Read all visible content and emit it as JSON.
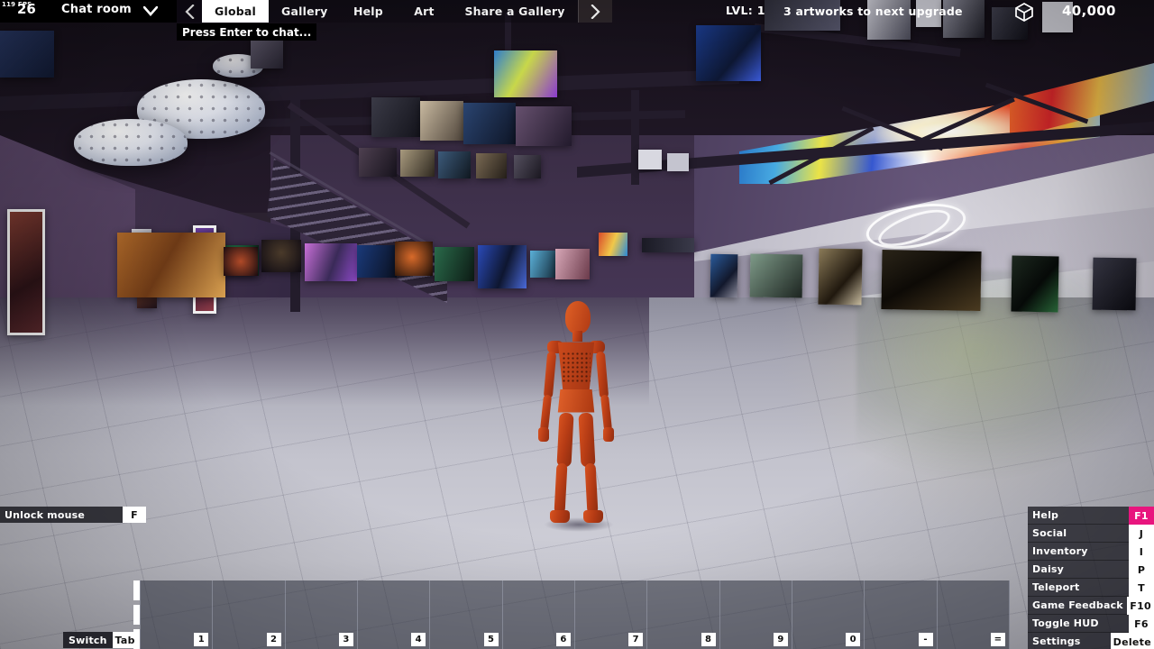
{
  "hud": {
    "performance": {
      "fps_label": "119 FPS",
      "ping": "26"
    },
    "chat": {
      "room_label": "Chat room",
      "dropdown_icon": "chevron-down-icon",
      "prev_icon": "chevron-left-icon",
      "next_icon": "chevron-right-icon",
      "hint": "Press Enter to chat...",
      "tabs": [
        {
          "label": "Global",
          "active": true
        },
        {
          "label": "Gallery",
          "active": false
        },
        {
          "label": "Help",
          "active": false
        },
        {
          "label": "Art",
          "active": false
        },
        {
          "label": "Share a Gallery",
          "active": false
        }
      ]
    },
    "status": {
      "level": "LVL: 1",
      "upgrade_progress": "3 artworks to next upgrade",
      "inventory_icon": "cube-icon",
      "currency": "40,000"
    },
    "unlock_mouse": {
      "label": "Unlock mouse",
      "key": "F"
    },
    "switch_hotbar": {
      "label": "Switch",
      "key": "Tab"
    },
    "menu": [
      {
        "label": "Help",
        "key": "F1",
        "highlight": true
      },
      {
        "label": "Social",
        "key": "J",
        "highlight": false
      },
      {
        "label": "Inventory",
        "key": "I",
        "highlight": false
      },
      {
        "label": "Daisy",
        "key": "P",
        "highlight": false
      },
      {
        "label": "Teleport",
        "key": "T",
        "highlight": false
      },
      {
        "label": "Game Feedback",
        "key": "F10",
        "highlight": false
      },
      {
        "label": "Toggle HUD",
        "key": "F6",
        "highlight": false
      },
      {
        "label": "Settings",
        "key": "Delete",
        "highlight": false
      }
    ],
    "hotbar": {
      "slots": [
        "1",
        "2",
        "3",
        "4",
        "5",
        "6",
        "7",
        "8",
        "9",
        "0",
        "-",
        "="
      ],
      "selected_index": 0
    },
    "colors": {
      "accent_pink": "#e8157e",
      "keycap_bg": "#ffffff",
      "panel_bg": "#1c1c24",
      "character": "#c4441a",
      "wall_purple": "#4b3a58"
    }
  },
  "scene": {
    "description": "Virtual art gallery interior, third-person view of an orange mannequin avatar",
    "avatar_name": "player-avatar"
  }
}
